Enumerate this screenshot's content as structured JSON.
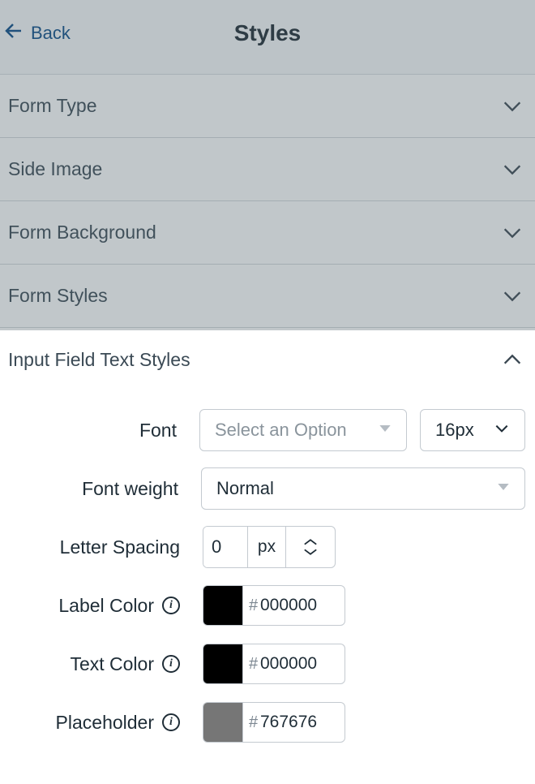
{
  "header": {
    "back_label": "Back",
    "title": "Styles"
  },
  "sections": [
    {
      "label": "Form Type",
      "expanded": false
    },
    {
      "label": "Side Image",
      "expanded": false
    },
    {
      "label": "Form Background",
      "expanded": false
    },
    {
      "label": "Form Styles",
      "expanded": false
    },
    {
      "label": "Input Field Text Styles",
      "expanded": true
    }
  ],
  "inputFieldTextStyles": {
    "font": {
      "label": "Font",
      "placeholder": "Select an Option",
      "size_value": "16px"
    },
    "font_weight": {
      "label": "Font weight",
      "value": "Normal"
    },
    "letter_spacing": {
      "label": "Letter Spacing",
      "value": "0",
      "unit": "px"
    },
    "label_color": {
      "label": "Label Color",
      "hex": "000000",
      "swatch": "#000000"
    },
    "text_color": {
      "label": "Text Color",
      "hex": "000000",
      "swatch": "#000000"
    },
    "placeholder": {
      "label": "Placeholder",
      "hex": "767676",
      "swatch": "#767676"
    }
  },
  "glyphs": {
    "hash": "#"
  }
}
